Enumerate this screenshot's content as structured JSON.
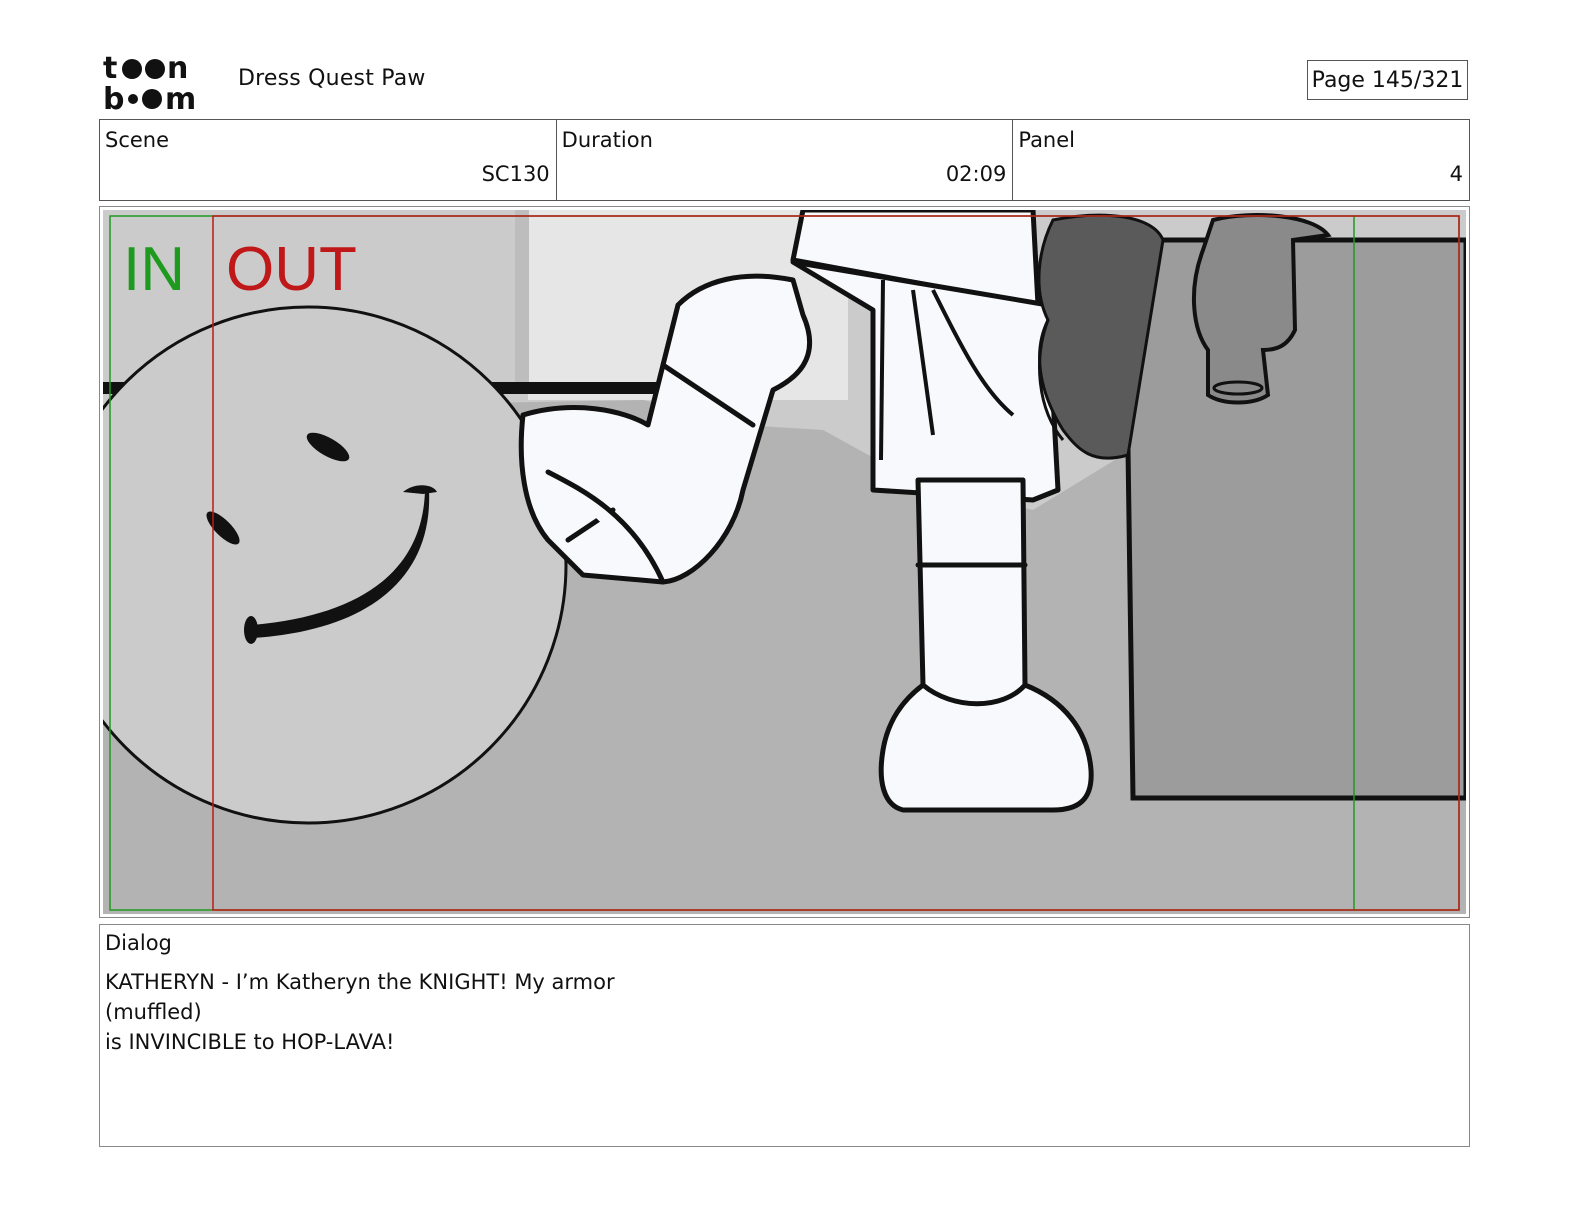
{
  "header": {
    "logo_text": "toonboom",
    "project_title": "Dress Quest Paw",
    "page_indicator": "Page 145/321"
  },
  "info": {
    "scene": {
      "label": "Scene",
      "value": "SC130"
    },
    "duration": {
      "label": "Duration",
      "value": "02:09"
    },
    "panel": {
      "label": "Panel",
      "value": "4"
    }
  },
  "panel_image": {
    "in_marker": "IN",
    "out_marker": "OUT",
    "colors": {
      "in_guide": "#1e9a1e",
      "out_guide": "#c01818"
    }
  },
  "dialog": {
    "label": "Dialog",
    "lines": [
      "KATHERYN - I’m Katheryn the KNIGHT! My armor",
      "(muffled)",
      "is INVINCIBLE to HOP-LAVA!"
    ]
  }
}
